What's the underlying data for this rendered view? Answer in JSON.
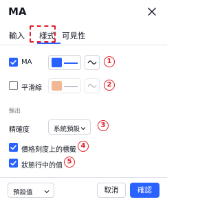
{
  "dialog": {
    "title": "MA"
  },
  "tabs": [
    {
      "label": "輸入"
    },
    {
      "label": "樣式"
    },
    {
      "label": "可見性"
    }
  ],
  "rows": [
    {
      "label": "MA",
      "checked": true,
      "color": "#2962ff",
      "badge": "1"
    },
    {
      "label": "平滑線",
      "checked": false,
      "color": "#f3b793",
      "badge": "2"
    }
  ],
  "output": {
    "section_label": "輸出",
    "precision_label": "精確度",
    "precision_value": "系統預設",
    "precision_badge": "3",
    "label_on_price_scale": "價格刻度上的標籤",
    "label_on_price_scale_badge": "4",
    "value_in_status_line": "狀態行中的值",
    "value_in_status_line_badge": "5"
  },
  "footer": {
    "template_label": "預設值",
    "cancel_label": "取消",
    "ok_label": "確認"
  },
  "colors": {
    "accent": "#2962ff",
    "highlight_red": "#e21c24"
  }
}
